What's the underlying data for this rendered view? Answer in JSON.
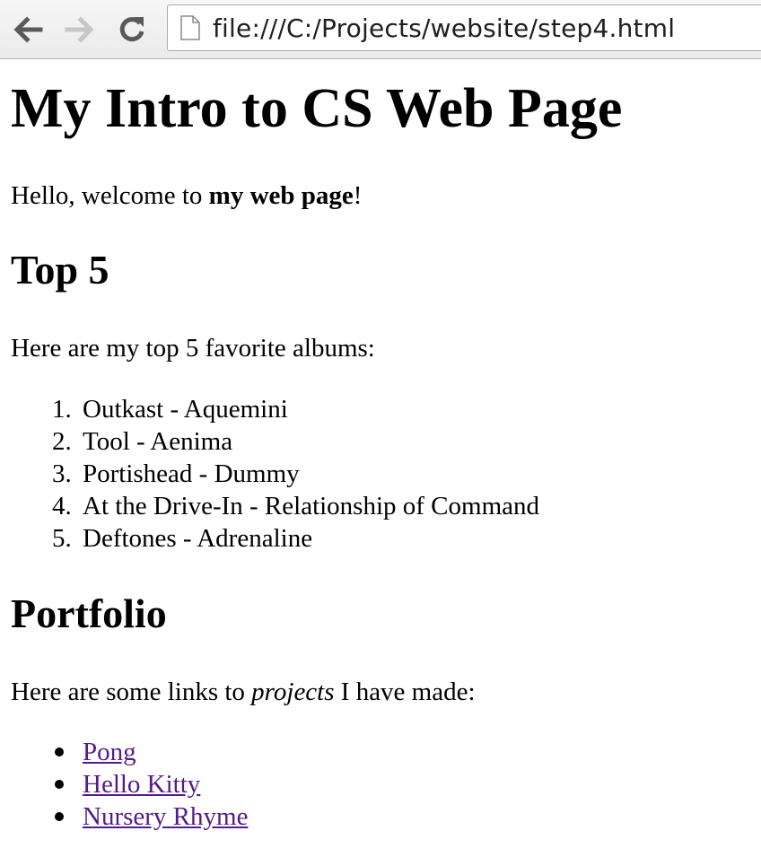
{
  "browser": {
    "url": "file:///C:/Projects/website/step4.html"
  },
  "page": {
    "title": "My Intro to CS Web Page",
    "intro": {
      "before": "Hello, welcome to ",
      "bold": "my web page",
      "after": "!"
    },
    "top5": {
      "heading": "Top 5",
      "intro": "Here are my top 5 favorite albums:",
      "items": [
        {
          "num": "1.",
          "text": "Outkast - Aquemini"
        },
        {
          "num": "2.",
          "text": "Tool - Aenima"
        },
        {
          "num": "3.",
          "text": "Portishead - Dummy"
        },
        {
          "num": "4.",
          "text": "At the Drive-In - Relationship of Command"
        },
        {
          "num": "5.",
          "text": "Deftones - Adrenaline"
        }
      ]
    },
    "portfolio": {
      "heading": "Portfolio",
      "intro_before": "Here are some links to ",
      "intro_italic": "projects",
      "intro_after": " I have made:",
      "links": [
        {
          "label": "Pong"
        },
        {
          "label": "Hello Kitty"
        },
        {
          "label": "Nursery Rhyme"
        }
      ]
    },
    "colors": {
      "visited_link": "#551a8b"
    }
  }
}
